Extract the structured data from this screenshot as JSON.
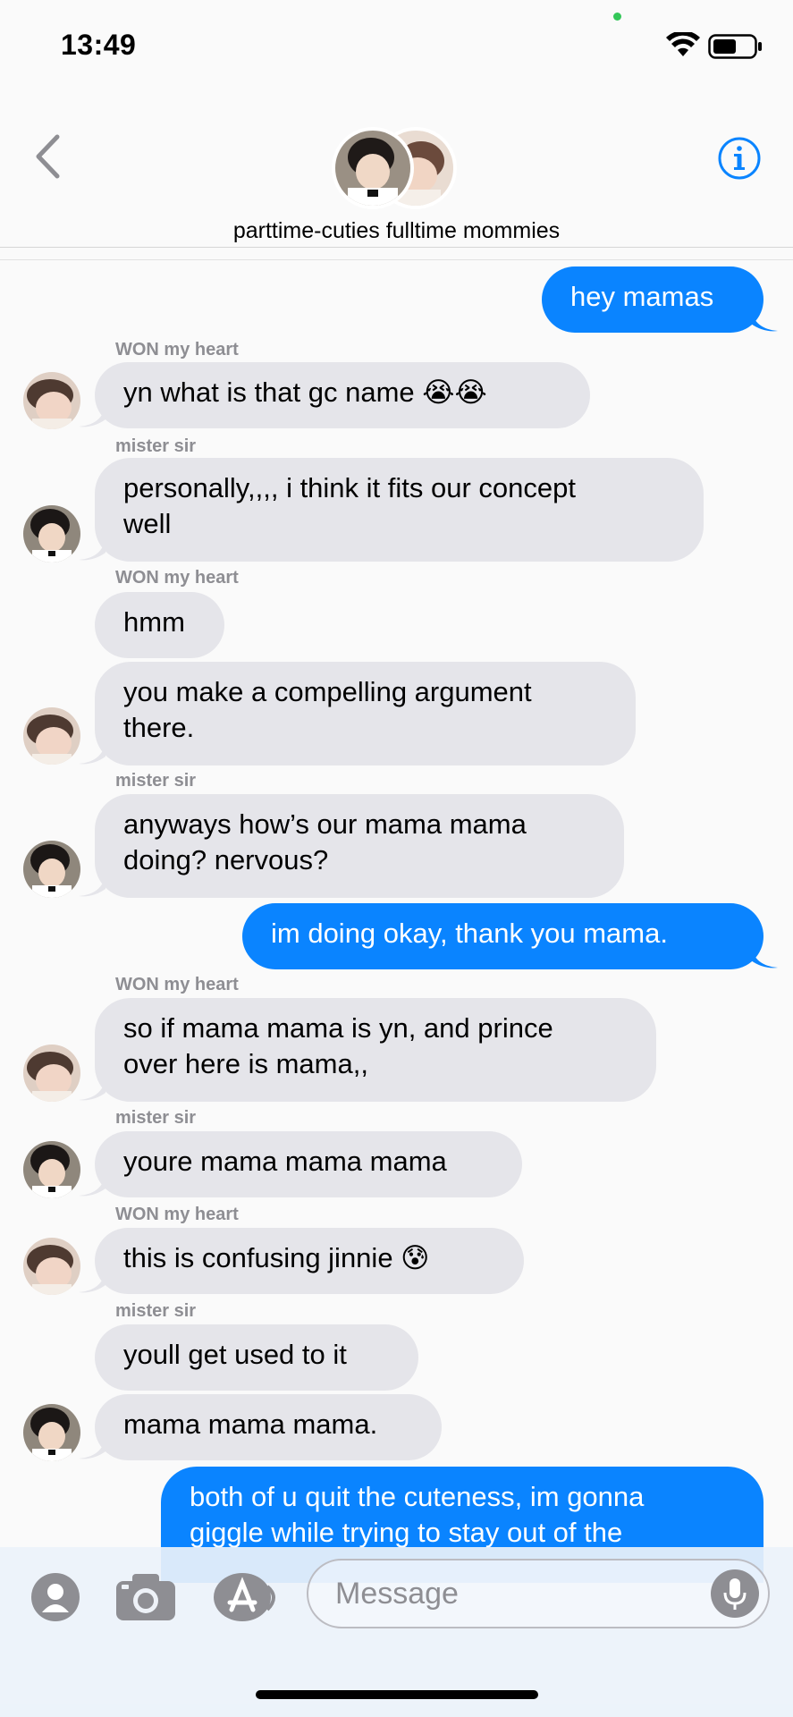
{
  "status": {
    "time": "13:49"
  },
  "chat": {
    "title": "parttime-cuties fulltime mommies"
  },
  "composer": {
    "placeholder": "Message"
  },
  "messages": {
    "m1": "hey mamas",
    "s1": "WON my heart",
    "m2": "yn what is that gc name 😭😭",
    "s2": "mister sir",
    "m3a": "personally,,,, i think it fits our concept",
    "m3b": "well",
    "s3": "WON my heart",
    "m4": "hmm",
    "m5a": "you make a compelling argument",
    "m5b": "there.",
    "s4": "mister sir",
    "m6a": "anyways how’s our mama mama",
    "m6b": "doing? nervous?",
    "m7": "im doing okay, thank you mama.",
    "s5": "WON my heart",
    "m8a": "so if mama mama is yn, and prince",
    "m8b": "over here is mama,,",
    "s6": "mister sir",
    "m9": "youre mama mama mama",
    "s7": "WON my heart",
    "m10": "this is confusing jinnie 😰",
    "s8": "mister sir",
    "m11": "youll get used to it",
    "m12": "mama mama mama.",
    "m13a": "both of u quit the cuteness, im gonna",
    "m13b": "giggle while trying to stay out of the"
  },
  "colors": {
    "outgoing": "#0a84ff",
    "incoming": "#e5e5ea",
    "sender": "#8e8e93"
  }
}
